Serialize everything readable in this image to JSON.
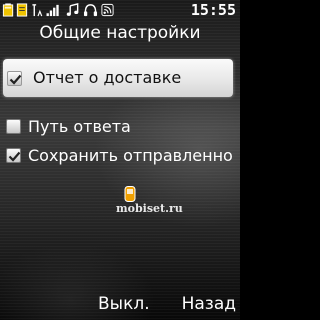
{
  "status_bar": {
    "time": "15:55",
    "icons": [
      "battery-icon",
      "message-icon",
      "signal-icon",
      "signal-bars-icon",
      "music-icon",
      "headset-icon",
      "rss-icon"
    ]
  },
  "screen": {
    "title": "Общие настройки"
  },
  "options": [
    {
      "label": "Отчет о доставке",
      "checked": true,
      "selected": true
    },
    {
      "label": "Путь ответа",
      "checked": false,
      "selected": false
    },
    {
      "label": "Сохранить отправленно",
      "checked": true,
      "selected": false
    }
  ],
  "watermark": "mobiset.ru",
  "softkeys": {
    "left": "Выкл.",
    "right": "Назад"
  },
  "colors": {
    "accent": "#f0c400",
    "text": "#ffffff",
    "selection": "#e8e8e8"
  }
}
